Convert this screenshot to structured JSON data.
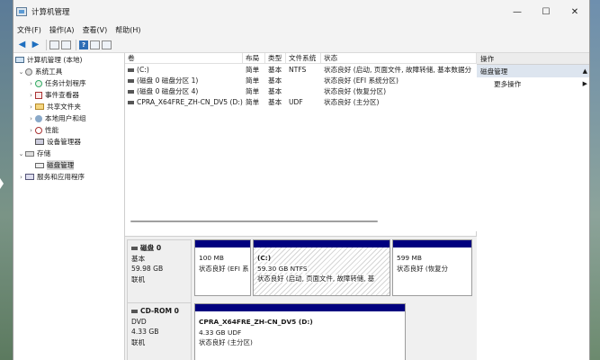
{
  "window": {
    "title": "计算机管理",
    "minimize": "—",
    "maximize": "☐",
    "close": "✕"
  },
  "menu": [
    "文件(F)",
    "操作(A)",
    "查看(V)",
    "帮助(H)"
  ],
  "tree": {
    "root": "计算机管理 (本地)",
    "system_tools": "系统工具",
    "task_scheduler": "任务计划程序",
    "event_viewer": "事件查看器",
    "shared_folders": "共享文件夹",
    "local_users": "本地用户和组",
    "performance": "性能",
    "device_manager": "设备管理器",
    "storage": "存储",
    "disk_management": "磁盘管理",
    "services_apps": "服务和应用程序"
  },
  "volume_table": {
    "headers": [
      "卷",
      "布局",
      "类型",
      "文件系统",
      "状态"
    ],
    "rows": [
      {
        "volume": "(C:)",
        "layout": "简单",
        "type": "基本",
        "fs": "NTFS",
        "status": "状态良好 (启动, 页面文件, 故障转储, 基本数据分"
      },
      {
        "volume": "(磁盘 0 磁盘分区 1)",
        "layout": "简单",
        "type": "基本",
        "fs": "",
        "status": "状态良好 (EFI 系统分区)"
      },
      {
        "volume": "(磁盘 0 磁盘分区 4)",
        "layout": "简单",
        "type": "基本",
        "fs": "",
        "status": "状态良好 (恢复分区)"
      },
      {
        "volume": "CPRA_X64FRE_ZH-CN_DV5 (D:)",
        "layout": "简单",
        "type": "基本",
        "fs": "UDF",
        "status": "状态良好 (主分区)"
      }
    ]
  },
  "disk0": {
    "name": "磁盘 0",
    "type": "基本",
    "size": "59.98 GB",
    "status": "联机",
    "partitions": [
      {
        "size": "100 MB",
        "status": "状态良好 (EFI 系"
      },
      {
        "label": "(C:)",
        "size": "59.30 GB NTFS",
        "status": "状态良好 (启动, 页面文件, 故障转储, 基"
      },
      {
        "size": "599 MB",
        "status": "状态良好 (恢复分"
      }
    ]
  },
  "cdrom0": {
    "name": "CD-ROM 0",
    "type": "DVD",
    "size": "4.33 GB",
    "status": "联机",
    "partition": {
      "label": "CPRA_X64FRE_ZH-CN_DV5  (D:)",
      "size": "4.33 GB UDF",
      "status": "状态良好 (主分区)"
    }
  },
  "actions": {
    "header": "操作",
    "section": "磁盘管理",
    "more": "更多操作"
  },
  "colors": {
    "partition_bar": "#00007f",
    "selection": "#dde5ef"
  }
}
